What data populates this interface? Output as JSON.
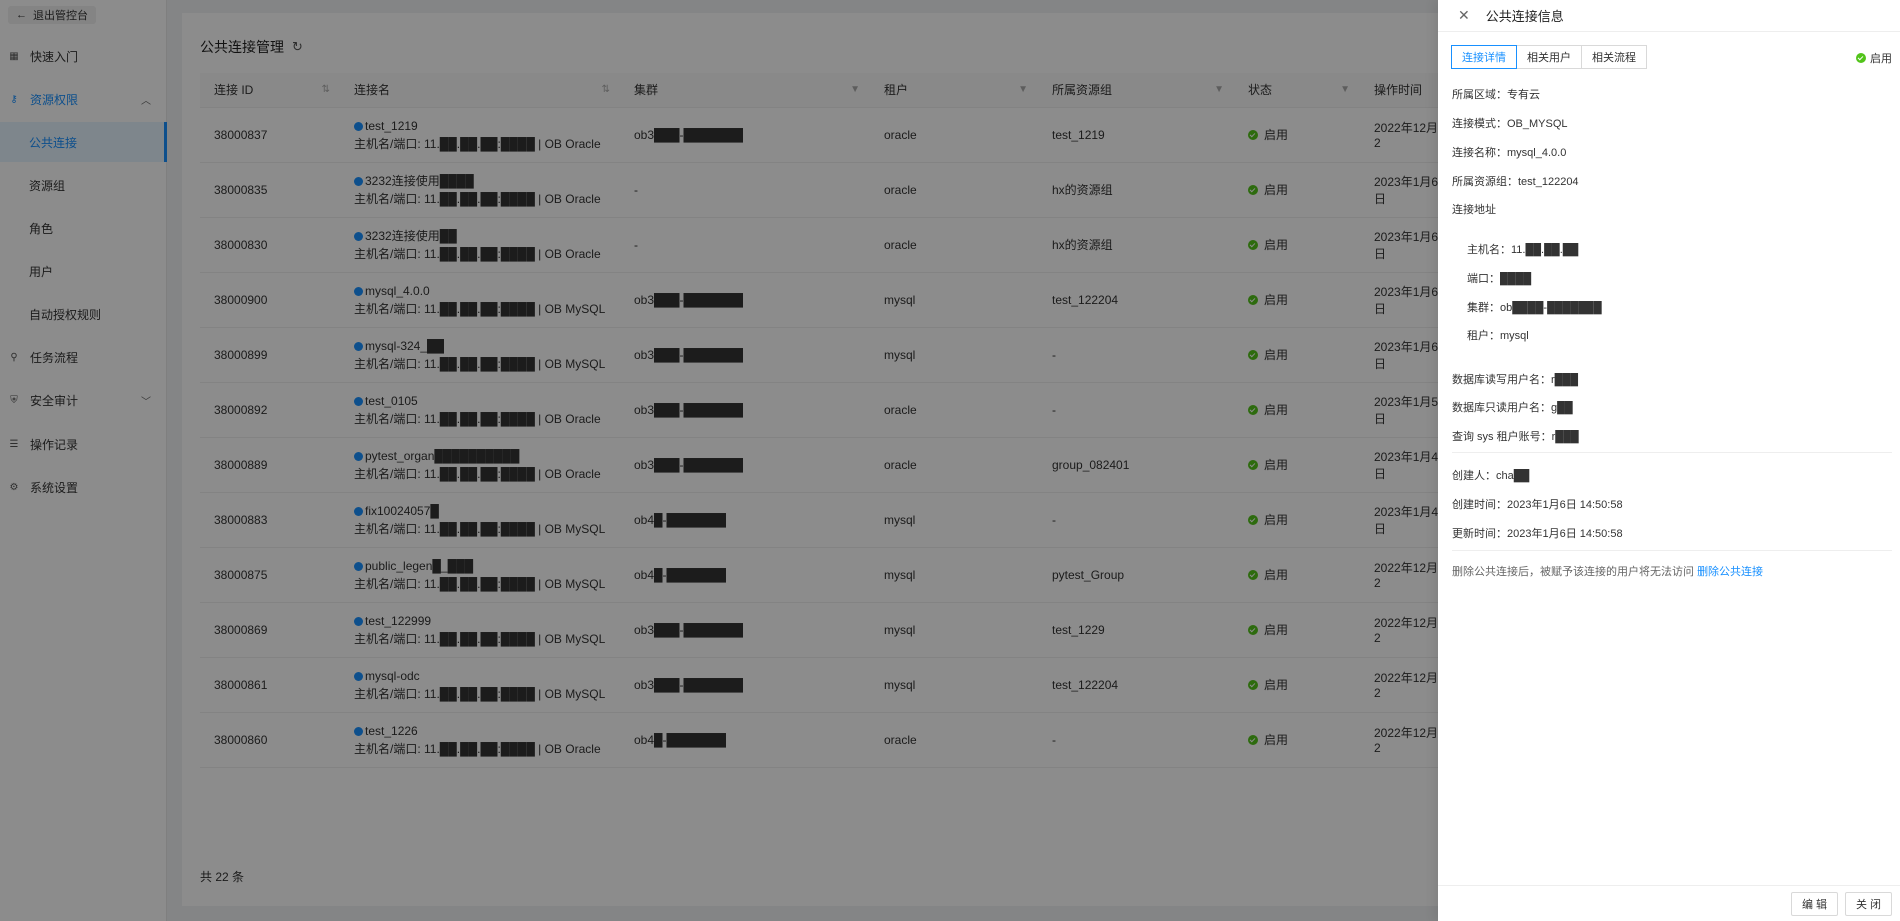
{
  "sidebar": {
    "back_label": "退出管控台",
    "items": [
      {
        "label": "快速入门",
        "icon": "grid-icon"
      },
      {
        "label": "资源权限",
        "icon": "key-icon"
      },
      {
        "label": "任务流程",
        "icon": "workflow-icon"
      },
      {
        "label": "安全审计",
        "icon": "shield-icon"
      },
      {
        "label": "操作记录",
        "icon": "list-icon"
      },
      {
        "label": "系统设置",
        "icon": "gear-icon"
      }
    ],
    "sub_items": [
      "公共连接",
      "资源组",
      "角色",
      "用户",
      "自动授权规则"
    ]
  },
  "main": {
    "title": "公共连接管理",
    "columns": [
      "连接 ID",
      "连接名",
      "集群",
      "租户",
      "所属资源组",
      "状态",
      "操作时间"
    ],
    "rows": [
      {
        "id": "38000837",
        "name": "test_1219",
        "host": "主机名/端口: 11.██.██.██:████ | OB Oracle",
        "cluster": "ob3███-███████",
        "tenant": "oracle",
        "group": "test_1219",
        "status": "启用",
        "time": "2022年12月2"
      },
      {
        "id": "38000835",
        "name": "3232连接使用████",
        "host": "主机名/端口: 11.██.██.██:████ | OB Oracle",
        "cluster": "-",
        "tenant": "oracle",
        "group": "hx的资源组",
        "status": "启用",
        "time": "2023年1月6日"
      },
      {
        "id": "38000830",
        "name": "3232连接使用██",
        "host": "主机名/端口: 11.██.██.██:████ | OB Oracle",
        "cluster": "-",
        "tenant": "oracle",
        "group": "hx的资源组",
        "status": "启用",
        "time": "2023年1月6日"
      },
      {
        "id": "38000900",
        "name": "mysql_4.0.0",
        "host": "主机名/端口: 11.██.██.██:████ | OB MySQL",
        "cluster": "ob3███-███████",
        "tenant": "mysql",
        "group": "test_122204",
        "status": "启用",
        "time": "2023年1月6日"
      },
      {
        "id": "38000899",
        "name": "mysql-324_██",
        "host": "主机名/端口: 11.██.██.██:████ | OB MySQL",
        "cluster": "ob3███-███████",
        "tenant": "mysql",
        "group": "-",
        "status": "启用",
        "time": "2023年1月6日"
      },
      {
        "id": "38000892",
        "name": "test_0105",
        "host": "主机名/端口: 11.██.██.██:████ | OB Oracle",
        "cluster": "ob3███-███████",
        "tenant": "oracle",
        "group": "-",
        "status": "启用",
        "time": "2023年1月5日"
      },
      {
        "id": "38000889",
        "name": "pytest_organ██████████",
        "host": "主机名/端口: 11.██.██.██:████ | OB Oracle",
        "cluster": "ob3███-███████",
        "tenant": "oracle",
        "group": "group_082401",
        "status": "启用",
        "time": "2023年1月4日"
      },
      {
        "id": "38000883",
        "name": "fix10024057█",
        "host": "主机名/端口: 11.██.██.██:████ | OB MySQL",
        "cluster": "ob4█-███████",
        "tenant": "mysql",
        "group": "-",
        "status": "启用",
        "time": "2023年1月4日"
      },
      {
        "id": "38000875",
        "name": "public_legen█_███",
        "host": "主机名/端口: 11.██.██.██:████ | OB MySQL",
        "cluster": "ob4█-███████",
        "tenant": "mysql",
        "group": "pytest_Group",
        "status": "启用",
        "time": "2022年12月2"
      },
      {
        "id": "38000869",
        "name": "test_122999",
        "host": "主机名/端口: 11.██.██.██:████ | OB MySQL",
        "cluster": "ob3███-███████",
        "tenant": "mysql",
        "group": "test_1229",
        "status": "启用",
        "time": "2022年12月2"
      },
      {
        "id": "38000861",
        "name": "mysql-odc",
        "host": "主机名/端口: 11.██.██.██:████ | OB MySQL",
        "cluster": "ob3███-███████",
        "tenant": "mysql",
        "group": "test_122204",
        "status": "启用",
        "time": "2022年12月2"
      },
      {
        "id": "38000860",
        "name": "test_1226",
        "host": "主机名/端口: 11.██.██.██:████ | OB Oracle",
        "cluster": "ob4█-███████",
        "tenant": "oracle",
        "group": "-",
        "status": "启用",
        "time": "2022年12月2"
      }
    ],
    "total": "共 22 条"
  },
  "drawer": {
    "title": "公共连接信息",
    "tabs": [
      "连接详情",
      "相关用户",
      "相关流程"
    ],
    "status": "启用",
    "fields": {
      "region": "所属区域：专有云",
      "mode": "连接模式：OB_MYSQL",
      "name": "连接名称：mysql_4.0.0",
      "group": "所属资源组：test_122204",
      "addr_title": "连接地址",
      "host": "主机名：11.██.██.██",
      "port": "端口：████",
      "cluster": "集群：ob████-███████",
      "tenant": "租户：mysql",
      "rw_user": "数据库读写用户名：r███",
      "ro_user": "数据库只读用户名：g██",
      "sys_user": "查询 sys 租户账号：r███",
      "creator": "创建人：cha██",
      "created": "创建时间：2023年1月6日 14:50:58",
      "updated": "更新时间：2023年1月6日 14:50:58"
    },
    "note": "删除公共连接后，被赋予该连接的用户将无法访问",
    "delete_link": "删除公共连接",
    "edit_label": "编 辑",
    "close_label": "关 闭"
  },
  "colors": {
    "accent": "#1890ff",
    "success": "#52c41a"
  }
}
